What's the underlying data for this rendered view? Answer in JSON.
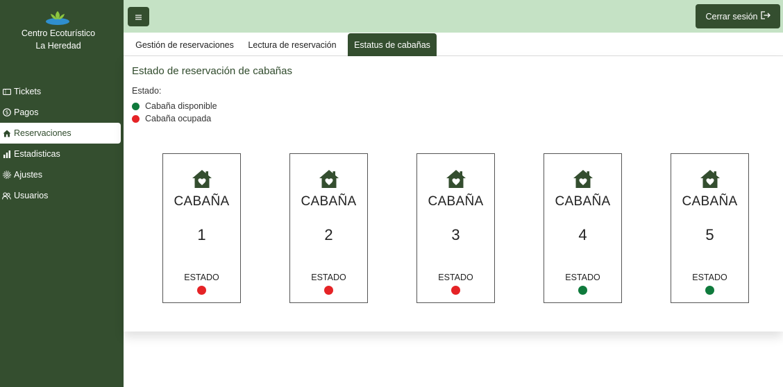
{
  "sidebar": {
    "brand_line1": "Centro Ecoturístico",
    "brand_line2": "La Heredad",
    "items": [
      {
        "label": "Tickets",
        "icon": "ticket-icon"
      },
      {
        "label": "Pagos",
        "icon": "dollar-circle-icon"
      },
      {
        "label": "Reservaciones",
        "icon": "house-icon",
        "active": true
      },
      {
        "label": "Estadisticas",
        "icon": "bar-chart-icon"
      },
      {
        "label": "Ajustes",
        "icon": "gear-icon"
      },
      {
        "label": "Usuarios",
        "icon": "users-icon"
      }
    ]
  },
  "topbar": {
    "menu_icon": "hamburger-icon",
    "logout_label": "Cerrar sesión",
    "logout_icon": "logout-icon"
  },
  "tabs": [
    {
      "label": "Gestión de reservaciones"
    },
    {
      "label": "Lectura de reservación"
    },
    {
      "label": "Estatus de cabañas",
      "active": true
    }
  ],
  "main": {
    "title": "Estado de reservación de cabañas",
    "legend_label": "Estado:",
    "legend": [
      {
        "label": "Cabaña disponible",
        "color": "#0f7a3c"
      },
      {
        "label": "Cabaña ocupada",
        "color": "#e52326"
      }
    ],
    "cabins": [
      {
        "title": "CABAÑA",
        "number": "1",
        "state_label": "ESTADO",
        "status": "ocupada"
      },
      {
        "title": "CABAÑA",
        "number": "2",
        "state_label": "ESTADO",
        "status": "ocupada"
      },
      {
        "title": "CABAÑA",
        "number": "3",
        "state_label": "ESTADO",
        "status": "ocupada"
      },
      {
        "title": "CABAÑA",
        "number": "4",
        "state_label": "ESTADO",
        "status": "disponible"
      },
      {
        "title": "CABAÑA",
        "number": "5",
        "state_label": "ESTADO",
        "status": "disponible"
      }
    ]
  },
  "colors": {
    "sidebar": "#344e2f",
    "topbar": "#c5e2c5",
    "available": "#0f7a3c",
    "occupied": "#e52326"
  }
}
